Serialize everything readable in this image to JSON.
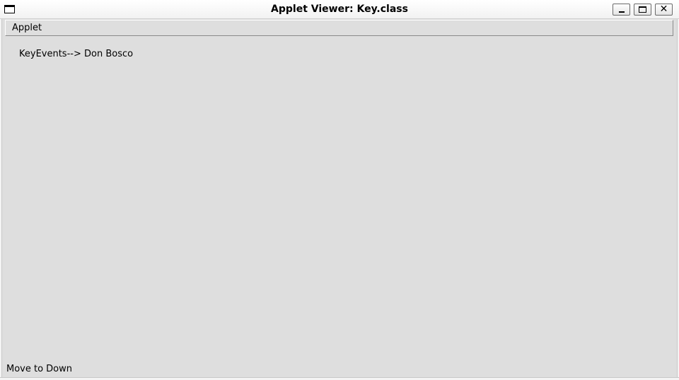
{
  "window": {
    "title": "Applet Viewer: Key.class"
  },
  "titlebar": {
    "icons": {
      "system": "window-menu-icon",
      "minimize": "minimize-icon",
      "maximize": "maximize-icon",
      "close": "close-icon"
    },
    "close_glyph": "✕"
  },
  "menubar": {
    "items": [
      {
        "label": "Applet"
      }
    ]
  },
  "content": {
    "key_events_text": "KeyEvents--> Don Bosco"
  },
  "status": {
    "text": "Move to Down"
  }
}
